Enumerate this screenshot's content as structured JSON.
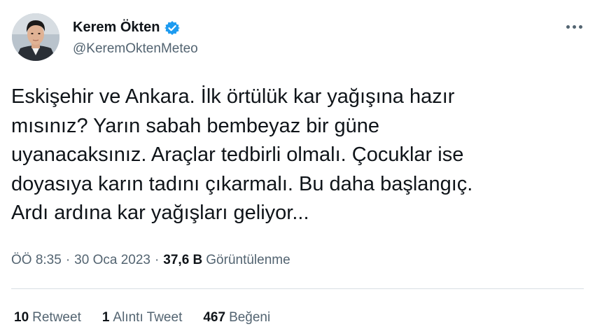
{
  "author": {
    "name": "Kerem Ökten",
    "handle": "@KeremOktenMeteo",
    "verified": true,
    "verified_color": "#1d9bf0"
  },
  "tweet": {
    "text": "Eskişehir ve Ankara. İlk örtülük kar yağışına hazır\nmısınız? Yarın sabah bembeyaz bir güne\nuyanacaksınız. Araçlar tedbirli olmalı. Çocuklar ise\ndoyasıya karın tadını çıkarmalı. Bu daha başlangıç.\nArdı ardına kar yağışları geliyor...",
    "time": "ÖÖ 8:35",
    "separator": "·",
    "date": "30 Oca 2023",
    "views_count": "37,6 B",
    "views_label": "Görüntülenme"
  },
  "stats": {
    "retweets_count": "10",
    "retweets_label": "Retweet",
    "quotes_count": "1",
    "quotes_label": "Alıntı Tweet",
    "likes_count": "467",
    "likes_label": "Beğeni"
  },
  "icons": {
    "more": "more-horizontal-icon",
    "verified": "verified-badge-icon"
  }
}
